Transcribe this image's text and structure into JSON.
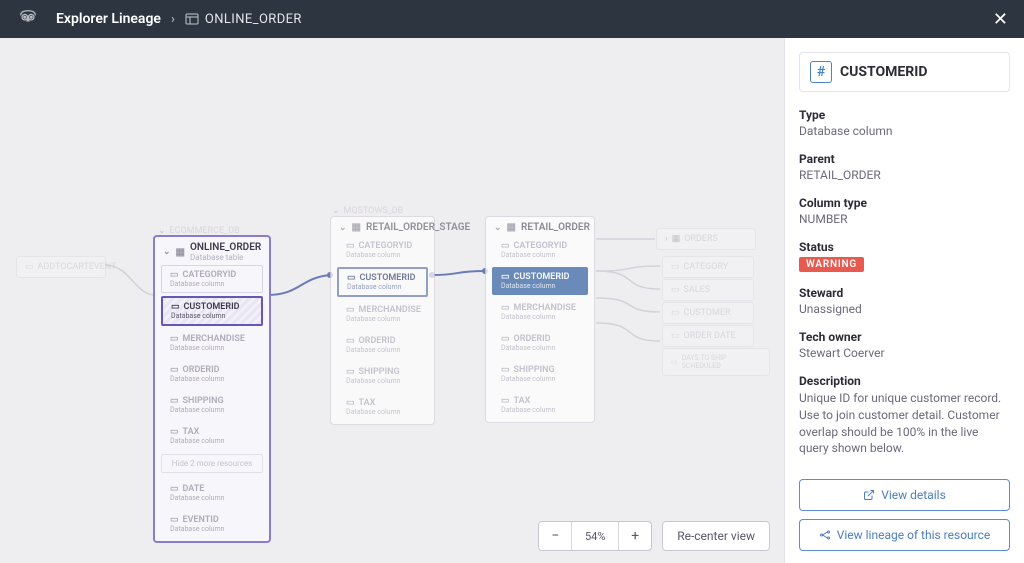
{
  "header": {
    "title": "Explorer Lineage",
    "breadcrumb": "ONLINE_ORDER"
  },
  "canvas": {
    "zoom_level": "54%",
    "recenter_label": "Re-center view",
    "upstream_mini": "ADDTOCARTEVENT",
    "ecommerce_header": "ECOMMERCE_DB",
    "focal": {
      "title": "ONLINE_ORDER",
      "subtitle": "Database table",
      "fields": [
        {
          "name": "CATEGORYID",
          "type": "Database column"
        },
        {
          "name": "CUSTOMERID",
          "type": "Database column"
        },
        {
          "name": "MERCHANDISE",
          "type": "Database column"
        },
        {
          "name": "ORDERID",
          "type": "Database column"
        },
        {
          "name": "SHIPPING",
          "type": "Database column"
        },
        {
          "name": "TAX",
          "type": "Database column"
        }
      ],
      "more": "Hide 2 more resources",
      "extra": [
        {
          "name": "DATE",
          "type": "Database column"
        },
        {
          "name": "EVENTID",
          "type": "Database column"
        }
      ]
    },
    "mqstows_header": "MQSTOWS_DB",
    "stage": {
      "title": "RETAIL_ORDER_STAGE",
      "fields": [
        {
          "name": "CATEGORYID",
          "type": "Database column"
        },
        {
          "name": "CUSTOMERID",
          "type": "Database column"
        },
        {
          "name": "MERCHANDISE",
          "type": "Database column"
        },
        {
          "name": "ORDERID",
          "type": "Database column"
        },
        {
          "name": "SHIPPING",
          "type": "Database column"
        },
        {
          "name": "TAX",
          "type": "Database column"
        }
      ]
    },
    "retail": {
      "title": "RETAIL_ORDER",
      "fields": [
        {
          "name": "CATEGORYID",
          "type": "Database column"
        },
        {
          "name": "CUSTOMERID",
          "type": "Database column"
        },
        {
          "name": "MERCHANDISE",
          "type": "Database column"
        },
        {
          "name": "ORDERID",
          "type": "Database column"
        },
        {
          "name": "SHIPPING",
          "type": "Database column"
        },
        {
          "name": "TAX",
          "type": "Database column"
        }
      ]
    },
    "orders_node": "ORDERS",
    "minis_right": [
      "CATEGORY",
      "SALES",
      "CUSTOMER",
      "ORDER DATE",
      "DAYS TO SHIP SCHEDULED"
    ]
  },
  "panel": {
    "title": "CUSTOMERID",
    "type_label": "Type",
    "type_value": "Database column",
    "parent_label": "Parent",
    "parent_value": "RETAIL_ORDER",
    "coltype_label": "Column type",
    "coltype_value": "NUMBER",
    "status_label": "Status",
    "status_value": "WARNING",
    "steward_label": "Steward",
    "steward_value": "Unassigned",
    "owner_label": "Tech owner",
    "owner_value": "Stewart Coerver",
    "desc_label": "Description",
    "desc_value": "Unique ID for unique customer record. Use to join customer detail. Customer overlap should be 100% in the live query shown below.",
    "view_details": "View details",
    "view_lineage": "View lineage of this resource"
  }
}
